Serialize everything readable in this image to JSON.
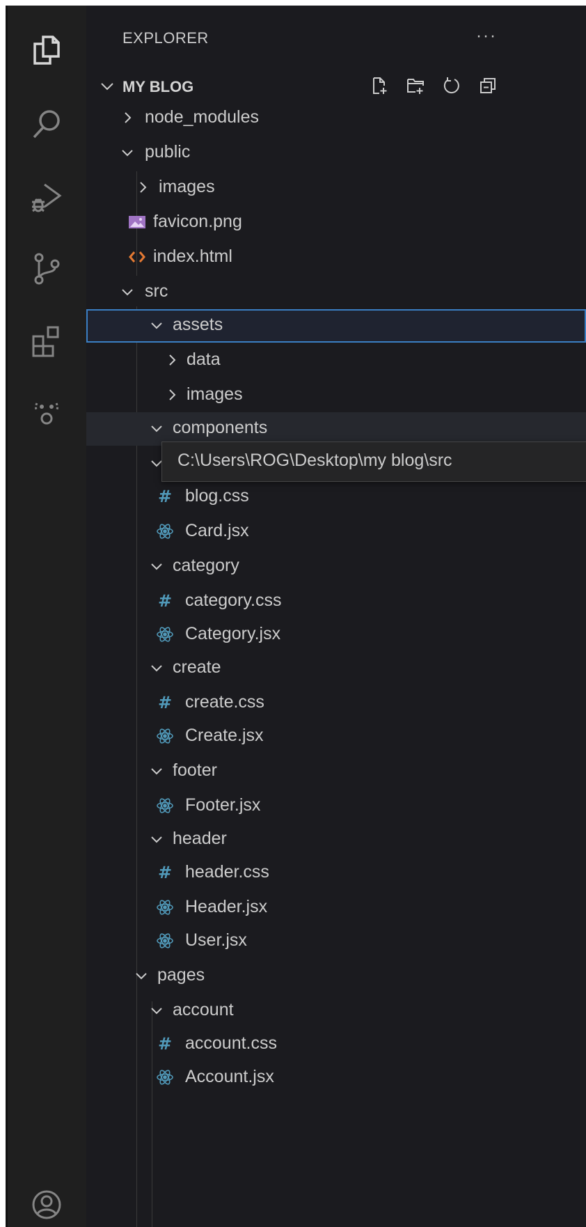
{
  "explorer": {
    "title": "EXPLORER",
    "more_actions": "···",
    "section_title": "MY BLOG"
  },
  "activity_bar": {
    "icons": [
      "explorer-icon",
      "search-icon",
      "run-debug-icon",
      "source-control-icon",
      "extensions-icon",
      "remote-explorer-icon",
      "accounts-icon"
    ]
  },
  "section_actions": [
    "new-file-icon",
    "new-folder-icon",
    "refresh-icon",
    "collapse-all-icon"
  ],
  "tree": {
    "node_modules": "node_modules",
    "public": "public",
    "public_images": "images",
    "favicon": "favicon.png",
    "index_html": "index.html",
    "src": "src",
    "assets": "assets",
    "data": "data",
    "assets_images": "images",
    "components": "components",
    "blog_css": "blog.css",
    "card_jsx": "Card.jsx",
    "category": "category",
    "category_css": "category.css",
    "category_jsx": "Category.jsx",
    "create": "create",
    "create_css": "create.css",
    "create_jsx": "Create.jsx",
    "footer": "footer",
    "footer_jsx": "Footer.jsx",
    "header": "header",
    "header_css": "header.css",
    "header_jsx": "Header.jsx",
    "user_jsx": "User.jsx",
    "pages": "pages",
    "account": "account",
    "account_css": "account.css",
    "account_jsx": "Account.jsx"
  },
  "tooltip": {
    "path": "C:\\Users\\ROG\\Desktop\\my blog\\src"
  },
  "colors": {
    "activity_bar_bg": "#1f1f1f",
    "sidebar_bg": "#1b1b1f",
    "focus_border": "#3b7fc4",
    "react_icon": "#519aba",
    "css_icon": "#519aba",
    "html_icon": "#e37933",
    "image_icon": "#a074c4"
  }
}
